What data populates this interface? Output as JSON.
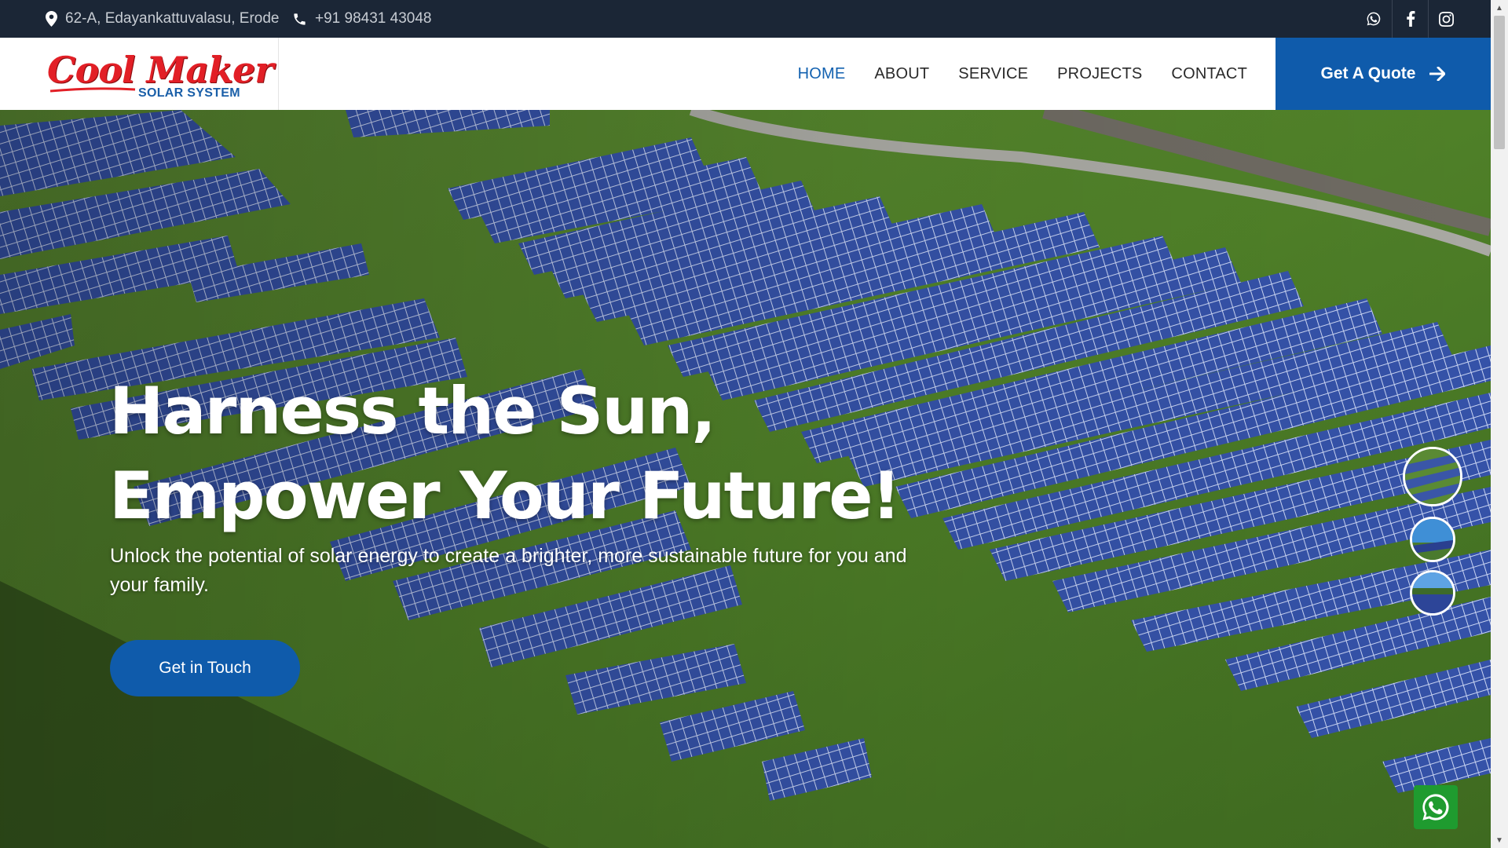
{
  "topbar": {
    "address": "62-A, Edayankattuvalasu, Erode",
    "phone": "+91 98431 43048",
    "social": [
      {
        "icon": "whatsapp-icon"
      },
      {
        "icon": "facebook-icon"
      },
      {
        "icon": "instagram-icon"
      }
    ]
  },
  "header": {
    "logo": {
      "main": "Cool Maker",
      "sub": "SOLAR SYSTEM"
    },
    "nav": [
      {
        "label": "HOME",
        "active": true
      },
      {
        "label": "ABOUT"
      },
      {
        "label": "SERVICE"
      },
      {
        "label": "PROJECTS"
      },
      {
        "label": "CONTACT"
      }
    ],
    "quote_label": "Get A Quote"
  },
  "hero": {
    "title_line1": "Harness the Sun,",
    "title_line2": "Empower Your Future!",
    "lead": "Unlock the potential of solar energy to create a brighter, more sustainable future for you and your family.",
    "cta_label": "Get in Touch",
    "slides": 3
  },
  "colors": {
    "topbar_bg": "#1b2636",
    "brand_blue": "#0f5bab",
    "logo_red": "#e21f26",
    "whatsapp_green": "#1f9b2f"
  }
}
